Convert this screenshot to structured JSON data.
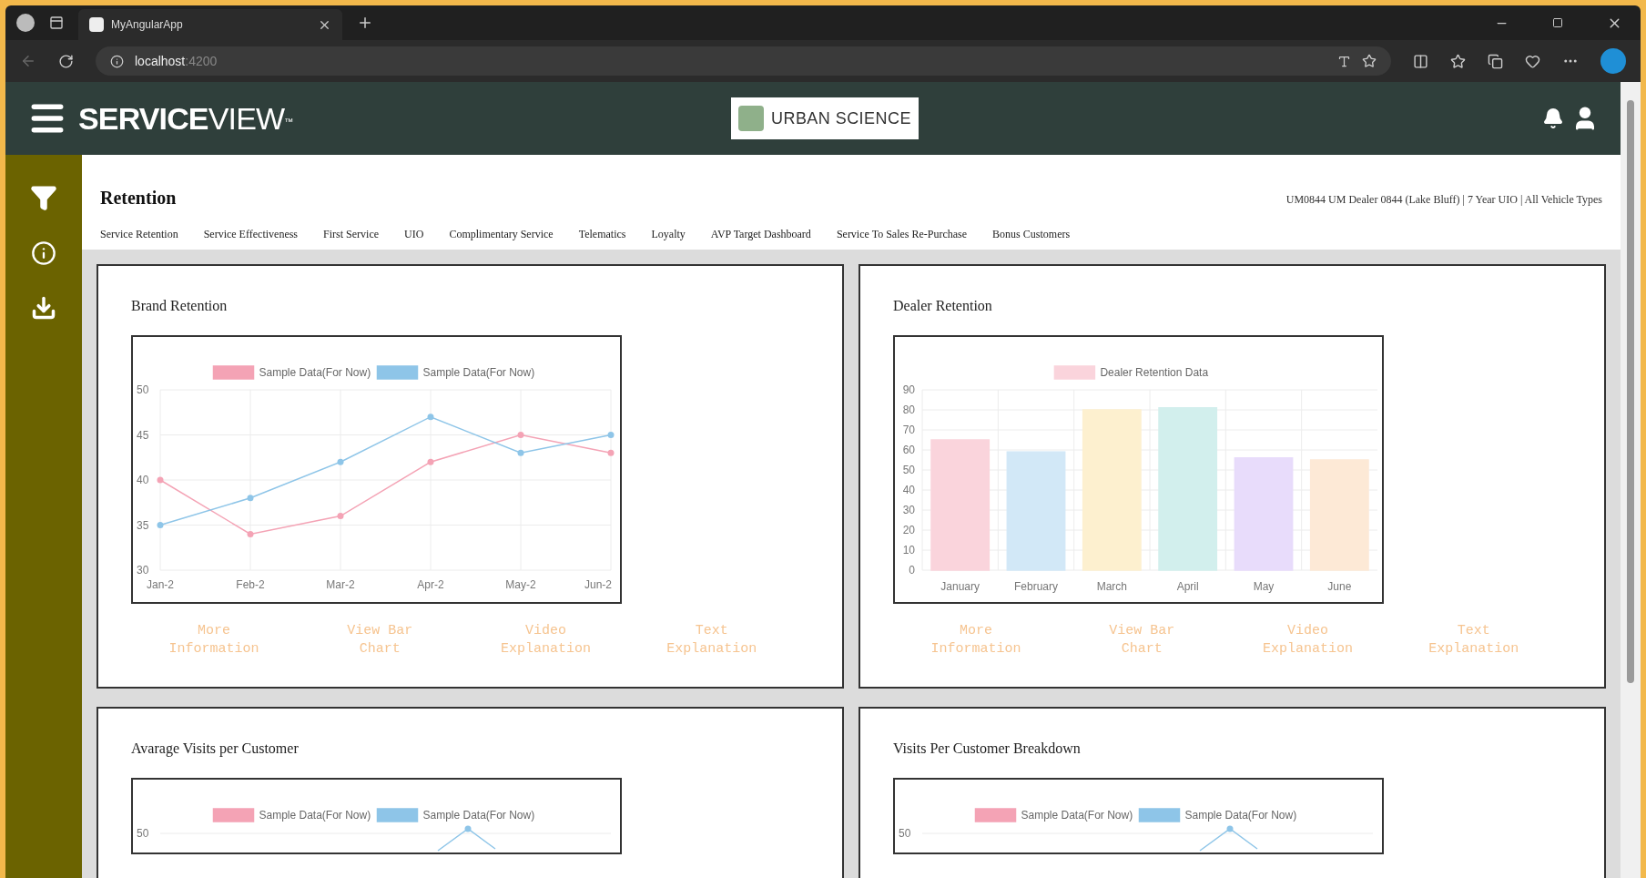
{
  "browser": {
    "tab_title": "MyAngularApp",
    "address_host": "localhost",
    "address_port": ":4200"
  },
  "header": {
    "brand_bold": "SERVICE",
    "brand_light": "VIEW",
    "brand_mark": "™",
    "logo_text": "URBAN SCIENCE"
  },
  "page": {
    "title": "Retention",
    "context": "UM0844 UM Dealer 0844 (Lake Bluff) | 7 Year UIO | All Vehicle Types",
    "tabs": [
      {
        "label": "Service Retention"
      },
      {
        "label": "Service Effectiveness"
      },
      {
        "label": "First Service"
      },
      {
        "label": "UIO"
      },
      {
        "label": "Complimentary Service"
      },
      {
        "label": "Telematics"
      },
      {
        "label": "Loyalty"
      },
      {
        "label": "AVP Target Dashboard"
      },
      {
        "label": "Service To Sales Re-Purchase"
      },
      {
        "label": "Bonus Customers"
      }
    ]
  },
  "cards": [
    {
      "title": "Brand Retention",
      "chart_data": {
        "type": "line",
        "grid": true,
        "categories": [
          "Jan-2",
          "Feb-2",
          "Mar-2",
          "Apr-2",
          "May-2",
          "Jun-2"
        ],
        "ylim": [
          30,
          50
        ],
        "yticks": [
          30,
          35,
          40,
          45,
          50
        ],
        "series": [
          {
            "name": "Sample Data(For Now)",
            "color": "#f4a3b5",
            "marker": true,
            "values": [
              40,
              34,
              36,
              42,
              45,
              43
            ]
          },
          {
            "name": "Sample Data(For Now)",
            "color": "#8ec5e8",
            "marker": true,
            "values": [
              35,
              38,
              42,
              47,
              43,
              45
            ]
          }
        ]
      },
      "links": [
        "More Information",
        "View Bar Chart",
        "Video Explanation",
        "Text Explanation"
      ]
    },
    {
      "title": "Dealer Retention",
      "bars": [
        {
          "color": "#fad4dc"
        },
        {
          "color": "#d2e8f7"
        },
        {
          "color": "#fdf0cf"
        },
        {
          "color": "#d2efed"
        },
        {
          "color": "#e8dcfb"
        },
        {
          "color": "#fde9d6"
        }
      ],
      "chart_data": {
        "type": "bar",
        "grid": true,
        "categories": [
          "January",
          "February",
          "March",
          "April",
          "May",
          "June"
        ],
        "ylim": [
          0,
          90
        ],
        "yticks": [
          0,
          10,
          20,
          30,
          40,
          50,
          60,
          70,
          80,
          90
        ],
        "series": [
          {
            "name": "Dealer Retention Data",
            "values": [
              65,
              59,
              80,
              81,
              56,
              55
            ]
          }
        ]
      },
      "links": [
        "More Information",
        "View Bar Chart",
        "Video Explanation",
        "Text Explanation"
      ]
    },
    {
      "title": "Avarage Visits per Customer",
      "legend": [
        {
          "name": "Sample Data(For Now)",
          "color": "#f4a3b5"
        },
        {
          "name": "Sample Data(For Now)",
          "color": "#8ec5e8"
        }
      ],
      "top_tick": "50"
    },
    {
      "title": "Visits Per Customer Breakdown",
      "legend": [
        {
          "name": "Sample Data(For Now)",
          "color": "#f4a3b5"
        },
        {
          "name": "Sample Data(For Now)",
          "color": "#8ec5e8"
        }
      ],
      "top_tick": "50"
    }
  ]
}
